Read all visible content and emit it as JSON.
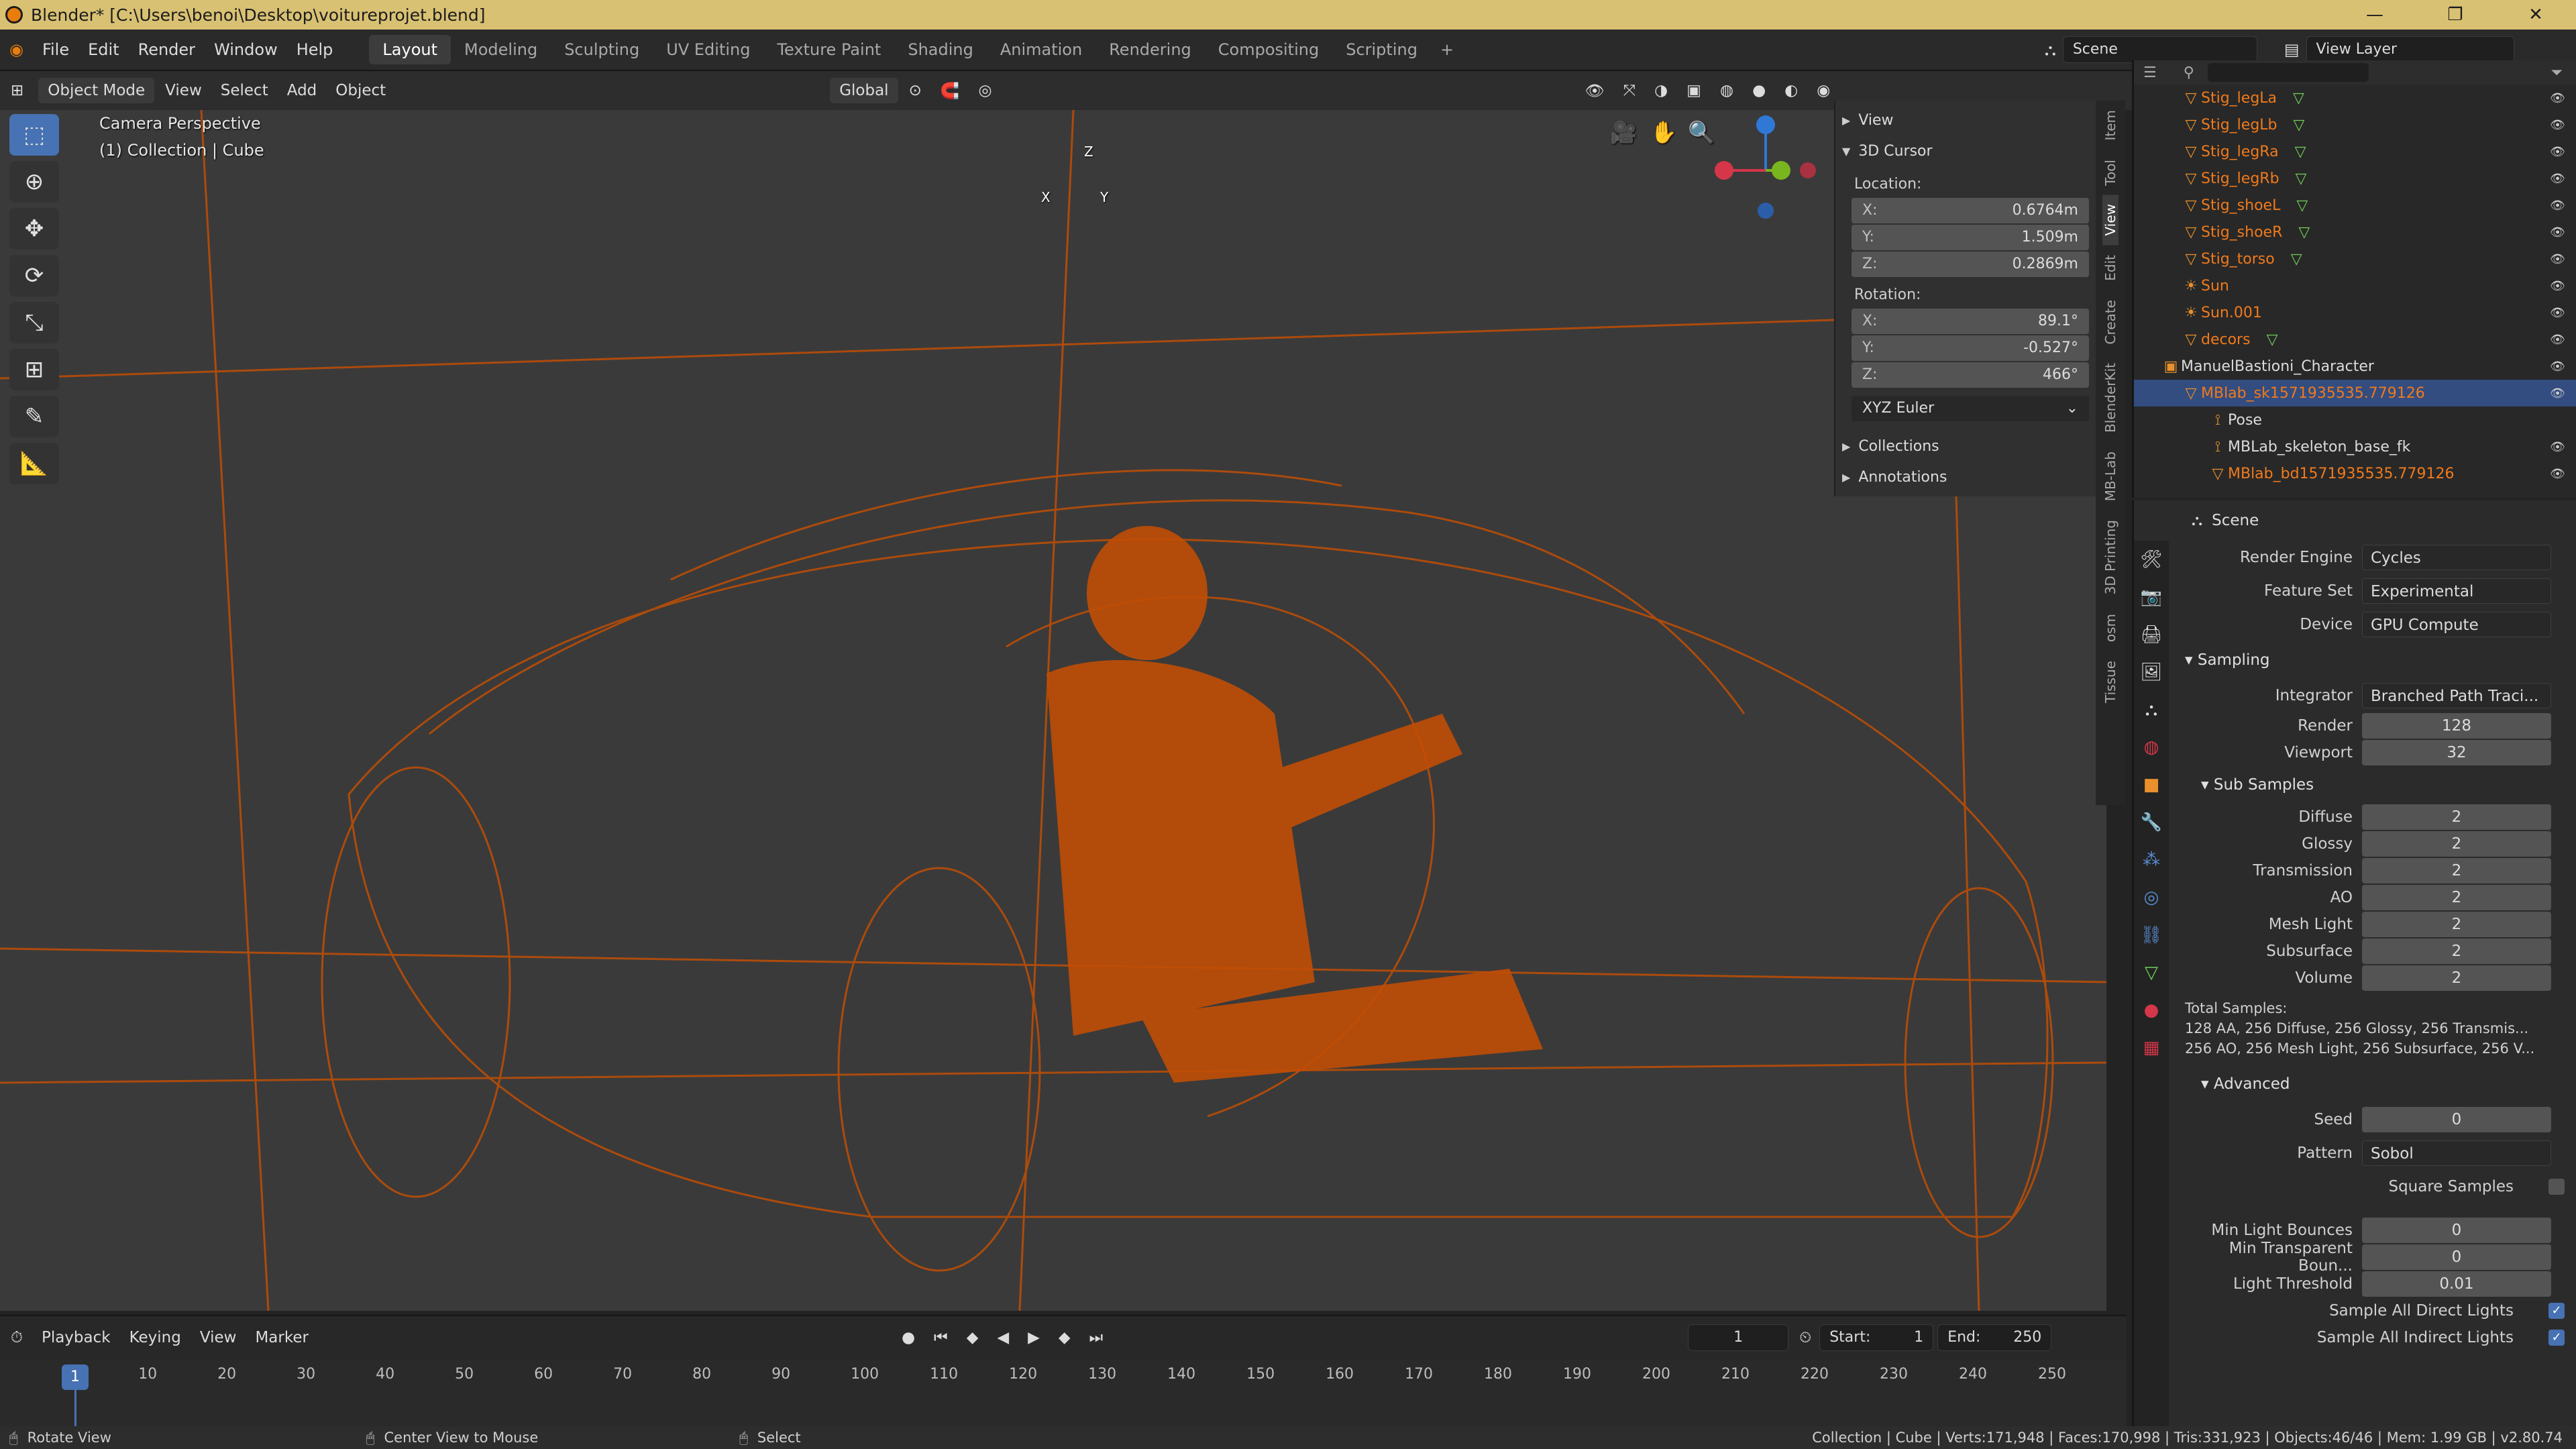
{
  "window": {
    "title": "Blender* [C:\\Users\\benoi\\Desktop\\voitureprojet.blend]",
    "minimize": "—",
    "maximize": "❐",
    "close": "✕"
  },
  "menu": [
    "File",
    "Edit",
    "Render",
    "Window",
    "Help"
  ],
  "workspaces": [
    "Layout",
    "Modeling",
    "Sculpting",
    "UV Editing",
    "Texture Paint",
    "Shading",
    "Animation",
    "Rendering",
    "Compositing",
    "Scripting"
  ],
  "add_workspace": "+",
  "scene": "Scene",
  "view_layer": "View Layer",
  "viewport_header": {
    "mode": "Object Mode",
    "menus": [
      "View",
      "Select",
      "Add",
      "Object"
    ],
    "transform": "Global"
  },
  "viewport": {
    "camera_label": "Camera Perspective",
    "collection_label": "(1) Collection | Cube",
    "axis_x": "X",
    "axis_y": "Y",
    "axis_z": "Z"
  },
  "npanel": {
    "view": "View",
    "cursor": "3D Cursor",
    "location": "Location:",
    "loc": [
      {
        "k": "X:",
        "v": "0.6764m"
      },
      {
        "k": "Y:",
        "v": "1.509m"
      },
      {
        "k": "Z:",
        "v": "0.2869m"
      }
    ],
    "rotation": "Rotation:",
    "rot": [
      {
        "k": "X:",
        "v": "89.1°"
      },
      {
        "k": "Y:",
        "v": "-0.527°"
      },
      {
        "k": "Z:",
        "v": "466°"
      }
    ],
    "mode": "XYZ Euler",
    "collections": "Collections",
    "annotations": "Annotations"
  },
  "side_tabs": [
    "Item",
    "Tool",
    "View",
    "Edit",
    "Create",
    "BlenderKit",
    "MB-Lab",
    "3D Printing",
    "osm",
    "Tissue"
  ],
  "outliner": [
    {
      "name": "Stig_legLa",
      "sel": false
    },
    {
      "name": "Stig_legLb",
      "sel": false
    },
    {
      "name": "Stig_legRa",
      "sel": false
    },
    {
      "name": "Stig_legRb",
      "sel": false
    },
    {
      "name": "Stig_shoeL",
      "sel": false
    },
    {
      "name": "Stig_shoeR",
      "sel": false
    },
    {
      "name": "Stig_torso",
      "sel": false
    },
    {
      "name": "Sun",
      "sel": false
    },
    {
      "name": "Sun.001",
      "sel": false
    },
    {
      "name": "decors",
      "sel": false
    },
    {
      "name": "ManuelBastioni_Character",
      "sel": false
    },
    {
      "name": "MBlab_sk1571935535.779126",
      "sel": true
    },
    {
      "name": "Pose",
      "sel": false
    },
    {
      "name": "MBLab_skeleton_base_fk",
      "sel": false
    },
    {
      "name": "MBlab_bd1571935535.779126",
      "sel": false
    }
  ],
  "props": {
    "header": "Scene",
    "render_engine": {
      "label": "Render Engine",
      "value": "Cycles"
    },
    "feature_set": {
      "label": "Feature Set",
      "value": "Experimental"
    },
    "device": {
      "label": "Device",
      "value": "GPU Compute"
    },
    "sampling": "Sampling",
    "integrator": {
      "label": "Integrator",
      "value": "Branched Path Traci..."
    },
    "render": {
      "label": "Render",
      "value": "128"
    },
    "viewport": {
      "label": "Viewport",
      "value": "32"
    },
    "sub_samples": "Sub Samples",
    "subs": [
      {
        "k": "Diffuse",
        "v": "2"
      },
      {
        "k": "Glossy",
        "v": "2"
      },
      {
        "k": "Transmission",
        "v": "2"
      },
      {
        "k": "AO",
        "v": "2"
      },
      {
        "k": "Mesh Light",
        "v": "2"
      },
      {
        "k": "Subsurface",
        "v": "2"
      },
      {
        "k": "Volume",
        "v": "2"
      }
    ],
    "total_label": "Total Samples:",
    "total_line1": "128 AA, 256 Diffuse, 256 Glossy, 256 Transmis...",
    "total_line2": "256 AO, 256 Mesh Light, 256 Subsurface, 256 V...",
    "advanced": "Advanced",
    "seed": {
      "label": "Seed",
      "value": "0"
    },
    "pattern": {
      "label": "Pattern",
      "value": "Sobol"
    },
    "square": "Square Samples",
    "min_bounces": {
      "label": "Min Light Bounces",
      "value": "0"
    },
    "min_transp": {
      "label": "Min Transparent Boun...",
      "value": "0"
    },
    "light_threshold": {
      "label": "Light Threshold",
      "value": "0.01"
    },
    "direct": "Sample All Direct Lights",
    "indirect": "Sample All Indirect Lights"
  },
  "timeline": {
    "menus": [
      "Playback",
      "Keying",
      "View",
      "Marker"
    ],
    "current": "1",
    "start": "Start:",
    "start_v": "1",
    "end": "End:",
    "end_v": "250",
    "ticks": [
      "1",
      "10",
      "20",
      "30",
      "40",
      "50",
      "60",
      "70",
      "80",
      "90",
      "100",
      "110",
      "120",
      "130",
      "140",
      "150",
      "160",
      "170",
      "180",
      "190",
      "200",
      "210",
      "220",
      "230",
      "240",
      "250"
    ]
  },
  "status": {
    "rotate": "Rotate View",
    "center": "Center View to Mouse",
    "select": "Select",
    "stats": "Collection | Cube | Verts:171,948 | Faces:170,998 | Tris:331,923 | Objects:46/46 | Mem: 1.99 GB | v2.80.74"
  }
}
